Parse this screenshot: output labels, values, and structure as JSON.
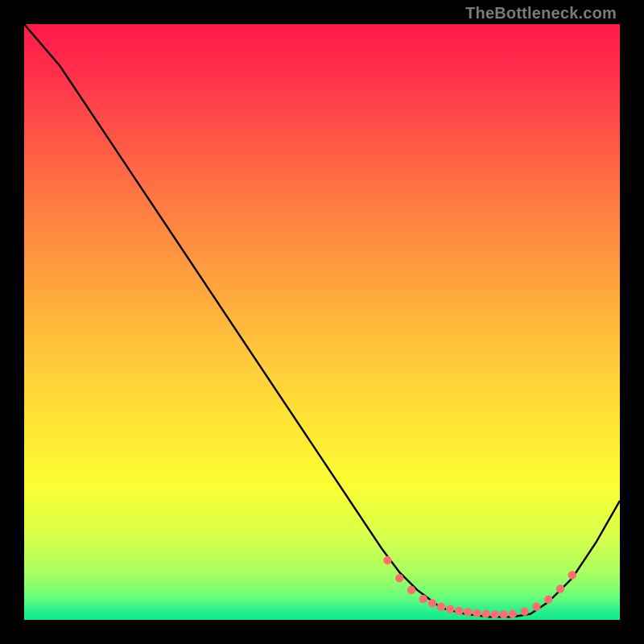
{
  "watermark": "TheBottleneck.com",
  "chart_data": {
    "type": "line",
    "title": "",
    "xlabel": "",
    "ylabel": "",
    "xlim": [
      0,
      100
    ],
    "ylim": [
      0,
      100
    ],
    "grid": false,
    "series": [
      {
        "name": "curve",
        "x": [
          0,
          6,
          12,
          18,
          24,
          30,
          36,
          42,
          48,
          54,
          60,
          63,
          66,
          70,
          74,
          78,
          82,
          85,
          88,
          92,
          96,
          100
        ],
        "y": [
          100,
          93,
          84,
          75,
          66,
          57,
          48,
          39,
          30,
          21,
          12,
          8,
          5,
          2,
          1,
          0.5,
          0.5,
          1,
          3,
          7,
          13,
          20
        ]
      }
    ],
    "markers": {
      "name": "highlight-dots",
      "x": [
        61,
        63,
        65,
        67,
        68.5,
        70,
        71.5,
        73,
        74.5,
        76,
        77.5,
        79,
        80.5,
        82,
        84,
        86,
        88,
        90,
        92
      ],
      "y": [
        10,
        7,
        5,
        3.5,
        2.8,
        2.2,
        1.8,
        1.5,
        1.3,
        1.1,
        1.0,
        0.9,
        0.9,
        1.0,
        1.4,
        2.2,
        3.4,
        5.2,
        7.5
      ]
    },
    "gradient_stops": [
      {
        "offset": 0.0,
        "color": "#ff1a4b"
      },
      {
        "offset": 0.08,
        "color": "#ff2f4a"
      },
      {
        "offset": 0.18,
        "color": "#ff5247"
      },
      {
        "offset": 0.3,
        "color": "#ff7a43"
      },
      {
        "offset": 0.42,
        "color": "#ff9e3f"
      },
      {
        "offset": 0.55,
        "color": "#ffc63a"
      },
      {
        "offset": 0.68,
        "color": "#ffe735"
      },
      {
        "offset": 0.78,
        "color": "#f9ff33"
      },
      {
        "offset": 0.86,
        "color": "#d8ff4a"
      },
      {
        "offset": 0.92,
        "color": "#aaff5f"
      },
      {
        "offset": 0.96,
        "color": "#6dff78"
      },
      {
        "offset": 0.985,
        "color": "#29f08e"
      },
      {
        "offset": 1.0,
        "color": "#13e989"
      }
    ],
    "marker_color": "#ff6e6e",
    "line_color": "#000000"
  }
}
